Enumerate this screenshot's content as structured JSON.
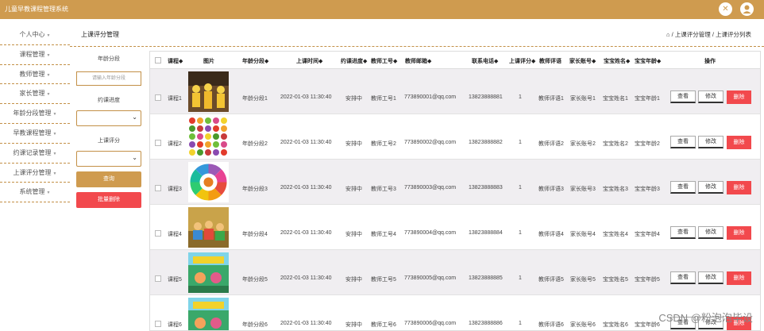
{
  "app": {
    "title": "儿童早教课程管理系统"
  },
  "topbar": {
    "settings_icon": "gear-icon",
    "user_icon": "user-icon"
  },
  "sidebar": {
    "items": [
      {
        "label": "个人中心"
      },
      {
        "label": "课程管理"
      },
      {
        "label": "教师管理"
      },
      {
        "label": "家长管理"
      },
      {
        "label": "年龄分段管理"
      },
      {
        "label": "早教课程管理"
      },
      {
        "label": "约课记录管理"
      },
      {
        "label": "上课评分管理"
      },
      {
        "label": "系统管理"
      }
    ]
  },
  "page": {
    "title": "上课评分管理",
    "breadcrumb": {
      "home_icon": "home-icon",
      "text": "/ 上课评分管理 / 上课评分列表"
    }
  },
  "filters": {
    "age_label": "年龄分段",
    "age_placeholder": "请输入年龄分段",
    "progress_label": "约课进度",
    "progress_value": "",
    "rating_label": "上课评分",
    "rating_value": "",
    "query_label": "查询",
    "batch_delete_label": "批量删除"
  },
  "table": {
    "headers": [
      "课程◆",
      "图片",
      "年龄分段◆",
      "上课时间◆",
      "约课进度◆",
      "教师工号◆",
      "教师邮箱◆",
      "联系电话◆",
      "上课评分◆",
      "教师评语",
      "家长账号◆",
      "宝宝姓名◆",
      "宝宝年龄◆",
      "操作"
    ],
    "action_labels": {
      "view": "查看",
      "edit": "修改",
      "delete": "删除"
    },
    "rows": [
      {
        "course": "课程1",
        "image": "kids-dancing-photo",
        "age_group": "年龄分段1",
        "time": "2022-01-03 11:30:40",
        "progress": "安排中",
        "teacher_id": "教师工号1",
        "email": "773890001@qq.com",
        "phone": "13823888881",
        "rating": "1",
        "comment": "教师评语1",
        "parent": "家长账号1",
        "baby_name": "宝宝姓名1",
        "baby_age": "宝宝年龄1"
      },
      {
        "course": "课程2",
        "image": "fruit-chart-photo",
        "age_group": "年龄分段2",
        "time": "2022-01-03 11:30:40",
        "progress": "安排中",
        "teacher_id": "教师工号2",
        "email": "773890002@qq.com",
        "phone": "13823888882",
        "rating": "1",
        "comment": "教师评语2",
        "parent": "家长账号2",
        "baby_name": "宝宝姓名2",
        "baby_age": "宝宝年龄2"
      },
      {
        "course": "课程3",
        "image": "color-wheel-photo",
        "age_group": "年龄分段3",
        "time": "2022-01-03 11:30:40",
        "progress": "安排中",
        "teacher_id": "教师工号3",
        "email": "773890003@qq.com",
        "phone": "13823888883",
        "rating": "1",
        "comment": "教师评语3",
        "parent": "家长账号3",
        "baby_name": "宝宝姓名3",
        "baby_age": "宝宝年龄3"
      },
      {
        "course": "课程4",
        "image": "classroom-photo",
        "age_group": "年龄分段4",
        "time": "2022-01-03 11:30:40",
        "progress": "安排中",
        "teacher_id": "教师工号4",
        "email": "773890004@qq.com",
        "phone": "13823888884",
        "rating": "1",
        "comment": "教师评语4",
        "parent": "家长账号4",
        "baby_name": "宝宝姓名4",
        "baby_age": "宝宝年龄4"
      },
      {
        "course": "课程5",
        "image": "cartoon-poster-photo",
        "age_group": "年龄分段5",
        "time": "2022-01-03 11:30:40",
        "progress": "安排中",
        "teacher_id": "教师工号5",
        "email": "773890005@qq.com",
        "phone": "13823888885",
        "rating": "1",
        "comment": "教师评语5",
        "parent": "家长账号5",
        "baby_name": "宝宝姓名5",
        "baby_age": "宝宝年龄5"
      },
      {
        "course": "课程6",
        "image": "cartoon-poster-photo",
        "age_group": "年龄分段6",
        "time": "2022-01-03 11:30:40",
        "progress": "安排中",
        "teacher_id": "教师工号6",
        "email": "773890006@qq.com",
        "phone": "13823888886",
        "rating": "1",
        "comment": "教师评语6",
        "parent": "家长账号6",
        "baby_name": "宝宝姓名6",
        "baby_age": "宝宝年龄6"
      }
    ]
  },
  "watermark": "CSDN @粉泡泡毕设",
  "colors": {
    "brand": "#cf9b4f",
    "danger": "#f2494d",
    "row_alt": "#f0eef1"
  }
}
